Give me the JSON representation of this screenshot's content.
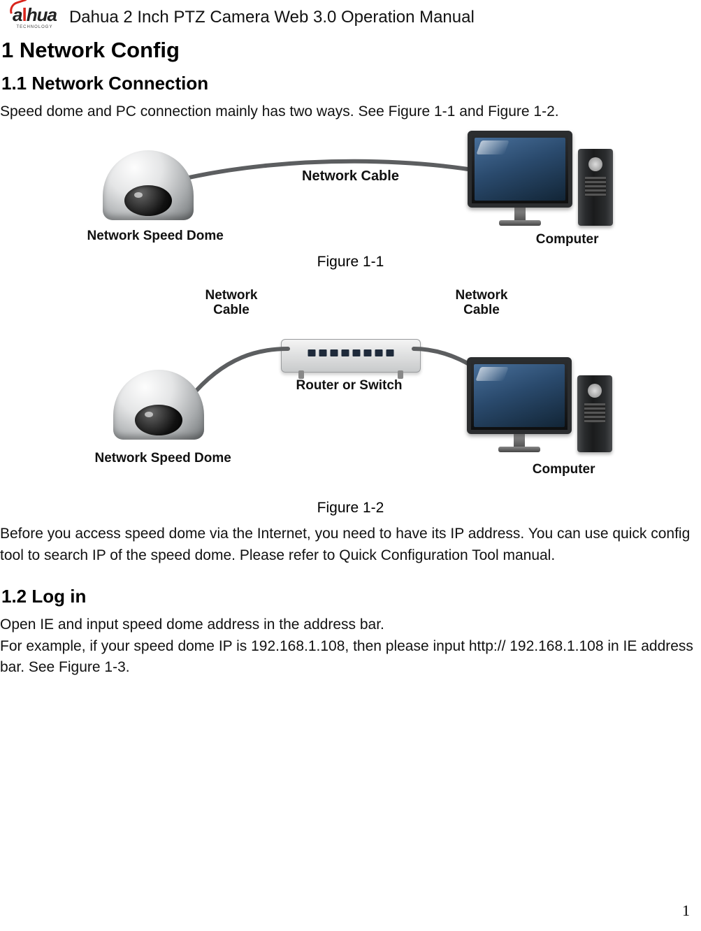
{
  "header": {
    "brand_prefix": "a",
    "brand_accent": "l",
    "brand_suffix": "hua",
    "brand_tag": "TECHNOLOGY",
    "doc_title": "Dahua 2 Inch PTZ Camera Web 3.0 Operation Manual"
  },
  "page_number": "1",
  "section_1": {
    "heading": "1  Network Config",
    "sub_1_1": {
      "heading": "1.1  Network Connection",
      "intro": "Speed dome and PC connection mainly has two ways. See Figure 1-1 and Figure 1-2.",
      "fig1": {
        "cable_label": "Network Cable",
        "dome_label": "Network Speed Dome",
        "pc_label": "Computer",
        "caption": "Figure 1-1"
      },
      "fig2": {
        "cable_left_l1": "Network",
        "cable_left_l2": "Cable",
        "cable_right_l1": "Network",
        "cable_right_l2": "Cable",
        "router_label": "Router or Switch",
        "dome_label": "Network Speed Dome",
        "pc_label": "Computer",
        "caption": "Figure 1-2"
      },
      "post_text": "Before you access speed dome via the Internet, you need to have its IP address. You can use quick config tool to search IP of the speed dome. Please refer to Quick Configuration Tool manual."
    },
    "sub_1_2": {
      "heading": "1.2  Log in",
      "para": "Open IE and input speed dome address in the address bar.\nFor example, if your speed dome IP is 192.168.1.108, then please input http:// 192.168.1.108 in IE address bar. See Figure 1-3."
    }
  }
}
